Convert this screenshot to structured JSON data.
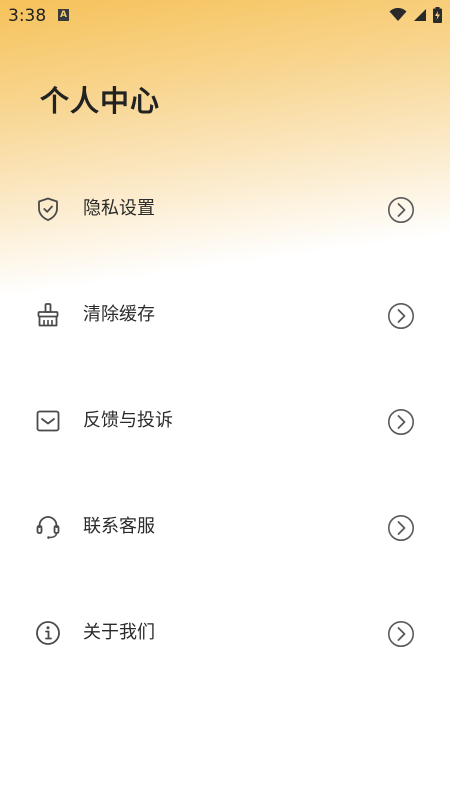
{
  "status_bar": {
    "time": "3:38",
    "notification_icon": "a-icon",
    "icons": [
      "wifi-icon",
      "signal-icon",
      "battery-charging-icon"
    ]
  },
  "page": {
    "title": "个人中心"
  },
  "menu": {
    "items": [
      {
        "label": "隐私设置",
        "icon": "shield-check-icon"
      },
      {
        "label": "清除缓存",
        "icon": "broom-icon"
      },
      {
        "label": "反馈与投诉",
        "icon": "mail-icon"
      },
      {
        "label": "联系客服",
        "icon": "headset-icon"
      },
      {
        "label": "关于我们",
        "icon": "info-icon"
      }
    ],
    "arrow_icon": "chevron-right-circle-icon"
  },
  "colors": {
    "gradient_top": "#f6c25a",
    "text": "#2b2b2b",
    "icon": "#4a4a4a"
  }
}
